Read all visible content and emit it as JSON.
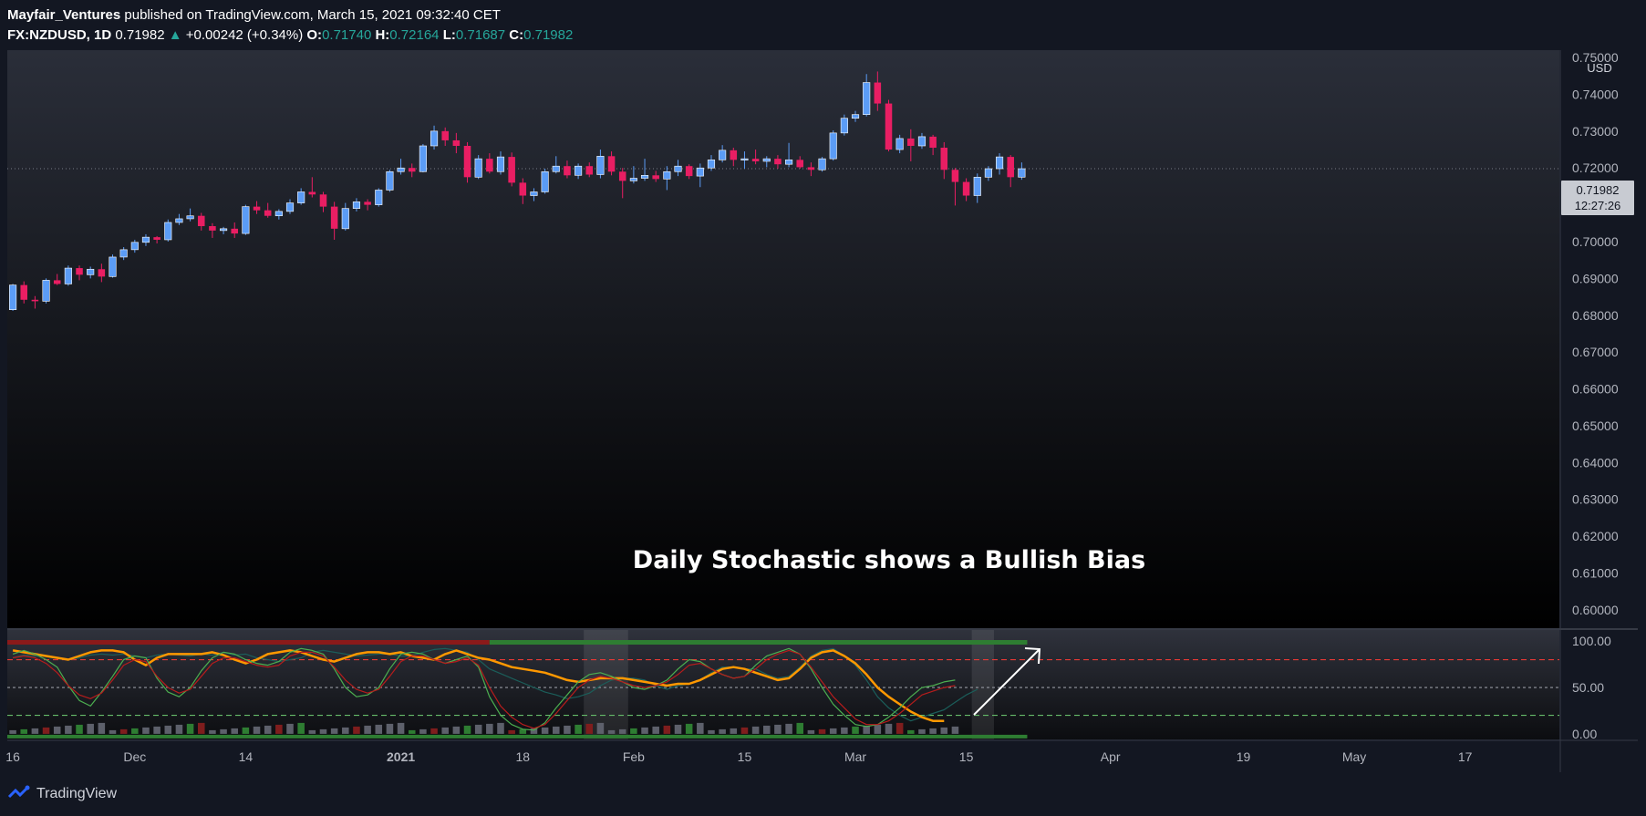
{
  "header": {
    "author": "Mayfair_Ventures",
    "published_text": "published on TradingView.com, March 15, 2021 09:32:40 CET",
    "symbol": "FX:NZDUSD, 1D",
    "last": "0.71982",
    "arrow": "▲",
    "change": "+0.00242 (+0.34%)",
    "o_label": "O:",
    "o": "0.71740",
    "h_label": "H:",
    "h": "0.72164",
    "l_label": "L:",
    "l": "0.71687",
    "c_label": "C:",
    "c": "0.71982"
  },
  "currency_label": "USD",
  "price_tag": {
    "price": "0.71982",
    "countdown": "12:27:26"
  },
  "annotation": "Daily Stochastic shows a Bullish Bias",
  "footer": {
    "brand": "TradingView"
  },
  "colors": {
    "background_top": "#2a2e39",
    "background_bottom": "#000000",
    "up": "#5b9cf6",
    "down": "#e91e63",
    "stoch_k": "#4caf50",
    "stoch_d": "#b71c1c",
    "orange": "#ff9800",
    "overbought_line": "#e53935",
    "oversold_line": "#66bb6a"
  },
  "chart_data": [
    {
      "type": "candlestick",
      "title": "",
      "ylim": [
        0.595,
        0.752
      ],
      "y_ticks": [
        "0.75000",
        "0.74000",
        "0.73000",
        "0.72000",
        "0.71000",
        "0.70000",
        "0.69000",
        "0.68000",
        "0.67000",
        "0.66000",
        "0.65000",
        "0.64000",
        "0.63000",
        "0.62000",
        "0.61000",
        "0.60000"
      ],
      "x_ticks": [
        {
          "label": "16",
          "i": 0
        },
        {
          "label": "Dec",
          "i": 11
        },
        {
          "label": "14",
          "i": 21
        },
        {
          "label": "2021",
          "i": 35
        },
        {
          "label": "18",
          "i": 46
        },
        {
          "label": "Feb",
          "i": 56
        },
        {
          "label": "15",
          "i": 66
        },
        {
          "label": "Mar",
          "i": 76
        },
        {
          "label": "15",
          "i": 86
        },
        {
          "label": "Apr",
          "i": 99
        },
        {
          "label": "19",
          "i": 111
        },
        {
          "label": "May",
          "i": 121
        },
        {
          "label": "17",
          "i": 131
        }
      ],
      "total_slots": 140,
      "last_price": 0.71982,
      "candles": [
        [
          0.6815,
          0.6885,
          0.6812,
          0.6882
        ],
        [
          0.6882,
          0.6892,
          0.6832,
          0.6842
        ],
        [
          0.6842,
          0.6852,
          0.6818,
          0.6838
        ],
        [
          0.6838,
          0.69,
          0.6832,
          0.6895
        ],
        [
          0.6895,
          0.6912,
          0.6882,
          0.6885
        ],
        [
          0.6885,
          0.6935,
          0.688,
          0.6928
        ],
        [
          0.6928,
          0.6935,
          0.6895,
          0.691
        ],
        [
          0.691,
          0.6932,
          0.69,
          0.6925
        ],
        [
          0.6925,
          0.694,
          0.689,
          0.6905
        ],
        [
          0.6905,
          0.6965,
          0.6902,
          0.6958
        ],
        [
          0.6958,
          0.6985,
          0.695,
          0.6978
        ],
        [
          0.6978,
          0.7005,
          0.697,
          0.6998
        ],
        [
          0.6998,
          0.702,
          0.6988,
          0.7012
        ],
        [
          0.7012,
          0.7015,
          0.6995,
          0.7005
        ],
        [
          0.7005,
          0.706,
          0.7,
          0.7052
        ],
        [
          0.7052,
          0.7075,
          0.7045,
          0.7062
        ],
        [
          0.7062,
          0.709,
          0.7055,
          0.707
        ],
        [
          0.707,
          0.7078,
          0.703,
          0.7042
        ],
        [
          0.7042,
          0.705,
          0.701,
          0.703
        ],
        [
          0.703,
          0.704,
          0.702,
          0.7035
        ],
        [
          0.7035,
          0.7052,
          0.701,
          0.7022
        ],
        [
          0.7022,
          0.71,
          0.7018,
          0.7095
        ],
        [
          0.7095,
          0.711,
          0.7075,
          0.7085
        ],
        [
          0.7085,
          0.7105,
          0.7065,
          0.707
        ],
        [
          0.707,
          0.7088,
          0.706,
          0.7082
        ],
        [
          0.7082,
          0.7115,
          0.7075,
          0.7105
        ],
        [
          0.7105,
          0.7145,
          0.71,
          0.7135
        ],
        [
          0.7135,
          0.7175,
          0.712,
          0.7128
        ],
        [
          0.7128,
          0.7135,
          0.708,
          0.7095
        ],
        [
          0.7095,
          0.7108,
          0.7005,
          0.7035
        ],
        [
          0.7035,
          0.7105,
          0.703,
          0.709
        ],
        [
          0.709,
          0.7118,
          0.7082,
          0.7108
        ],
        [
          0.7108,
          0.7115,
          0.7085,
          0.71
        ],
        [
          0.71,
          0.7145,
          0.7095,
          0.714
        ],
        [
          0.714,
          0.7195,
          0.7135,
          0.719
        ],
        [
          0.719,
          0.7225,
          0.7182,
          0.72
        ],
        [
          0.72,
          0.7212,
          0.7175,
          0.719
        ],
        [
          0.719,
          0.7265,
          0.7188,
          0.726
        ],
        [
          0.726,
          0.7315,
          0.725,
          0.73
        ],
        [
          0.73,
          0.731,
          0.726,
          0.7275
        ],
        [
          0.7275,
          0.7295,
          0.724,
          0.726
        ],
        [
          0.726,
          0.727,
          0.716,
          0.7175
        ],
        [
          0.7175,
          0.7235,
          0.717,
          0.7225
        ],
        [
          0.7225,
          0.724,
          0.7185,
          0.719
        ],
        [
          0.719,
          0.7245,
          0.7182,
          0.723
        ],
        [
          0.723,
          0.7242,
          0.715,
          0.716
        ],
        [
          0.716,
          0.7172,
          0.7102,
          0.7125
        ],
        [
          0.7125,
          0.7145,
          0.711,
          0.7135
        ],
        [
          0.7135,
          0.7198,
          0.713,
          0.719
        ],
        [
          0.719,
          0.7232,
          0.7185,
          0.7205
        ],
        [
          0.7205,
          0.722,
          0.7172,
          0.718
        ],
        [
          0.718,
          0.7212,
          0.717,
          0.7205
        ],
        [
          0.7205,
          0.7215,
          0.7175,
          0.7182
        ],
        [
          0.7182,
          0.725,
          0.7172,
          0.7232
        ],
        [
          0.7232,
          0.7245,
          0.718,
          0.719
        ],
        [
          0.719,
          0.72,
          0.7118,
          0.7165
        ],
        [
          0.7165,
          0.7205,
          0.7158,
          0.7172
        ],
        [
          0.7172,
          0.7225,
          0.7165,
          0.718
        ],
        [
          0.718,
          0.7192,
          0.7162,
          0.717
        ],
        [
          0.717,
          0.7205,
          0.714,
          0.719
        ],
        [
          0.719,
          0.7222,
          0.7178,
          0.7205
        ],
        [
          0.7205,
          0.721,
          0.717,
          0.7178
        ],
        [
          0.7178,
          0.7212,
          0.7148,
          0.72
        ],
        [
          0.72,
          0.7235,
          0.7192,
          0.7222
        ],
        [
          0.7222,
          0.7262,
          0.7215,
          0.7248
        ],
        [
          0.7248,
          0.7255,
          0.7205,
          0.7222
        ],
        [
          0.7222,
          0.7245,
          0.7198,
          0.7225
        ],
        [
          0.7225,
          0.725,
          0.721,
          0.7218
        ],
        [
          0.7218,
          0.7232,
          0.7202,
          0.7225
        ],
        [
          0.7225,
          0.7235,
          0.7198,
          0.721
        ],
        [
          0.721,
          0.7268,
          0.7202,
          0.7222
        ],
        [
          0.7222,
          0.7232,
          0.7198,
          0.7202
        ],
        [
          0.7202,
          0.7215,
          0.7178,
          0.7195
        ],
        [
          0.7195,
          0.723,
          0.719,
          0.7225
        ],
        [
          0.7225,
          0.7302,
          0.722,
          0.7295
        ],
        [
          0.7295,
          0.7345,
          0.7288,
          0.7335
        ],
        [
          0.7335,
          0.7355,
          0.7325,
          0.7345
        ],
        [
          0.7345,
          0.7455,
          0.734,
          0.7432
        ],
        [
          0.7432,
          0.7462,
          0.7355,
          0.7375
        ],
        [
          0.7375,
          0.7385,
          0.7245,
          0.725
        ],
        [
          0.725,
          0.729,
          0.724,
          0.728
        ],
        [
          0.728,
          0.7305,
          0.7218,
          0.726
        ],
        [
          0.726,
          0.7295,
          0.7252,
          0.7285
        ],
        [
          0.7285,
          0.729,
          0.7235,
          0.7255
        ],
        [
          0.7255,
          0.727,
          0.717,
          0.7195
        ],
        [
          0.7195,
          0.72,
          0.7098,
          0.7162
        ],
        [
          0.7162,
          0.7172,
          0.711,
          0.7125
        ],
        [
          0.7125,
          0.7185,
          0.7105,
          0.7175
        ],
        [
          0.7175,
          0.7205,
          0.7165,
          0.7198
        ],
        [
          0.7198,
          0.724,
          0.7182,
          0.723
        ],
        [
          0.723,
          0.7235,
          0.7148,
          0.7175
        ],
        [
          0.7175,
          0.7215,
          0.7168,
          0.7198
        ]
      ]
    },
    {
      "type": "line",
      "title": "",
      "ylim": [
        -6,
        112
      ],
      "y_ticks": [
        "100.00",
        "50.00",
        "0.00"
      ],
      "levels": [
        80,
        50,
        20
      ],
      "series": [
        {
          "values": [
            82,
            85,
            84,
            84,
            82,
            80,
            82,
            85,
            86,
            85,
            86,
            84,
            82,
            85,
            86,
            85,
            84,
            86,
            85,
            88,
            85,
            86,
            82,
            80,
            78,
            80,
            82,
            88,
            90,
            88,
            86,
            84,
            85,
            86,
            86,
            84,
            84,
            88,
            91,
            92,
            90,
            88,
            80,
            70,
            65,
            60,
            55,
            50,
            45,
            42,
            38,
            40,
            44,
            52,
            58,
            60,
            60,
            58,
            52,
            48,
            52,
            54,
            58,
            66,
            72,
            72,
            70,
            70,
            64,
            60,
            62,
            72,
            84,
            90,
            92,
            84,
            74,
            58,
            40,
            28,
            20,
            14,
            18,
            22,
            26,
            34,
            42,
            48
          ]
        },
        {
          "values": [
            90,
            88,
            86,
            84,
            82,
            80,
            84,
            88,
            90,
            90,
            88,
            80,
            74,
            82,
            86,
            86,
            86,
            86,
            88,
            85,
            80,
            76,
            80,
            86,
            88,
            90,
            88,
            84,
            80,
            78,
            82,
            86,
            88,
            88,
            86,
            88,
            84,
            82,
            80,
            86,
            90,
            86,
            82,
            80,
            76,
            72,
            70,
            68,
            66,
            62,
            58,
            56,
            58,
            60,
            60,
            60,
            58,
            56,
            54,
            52,
            54,
            54,
            58,
            64,
            70,
            72,
            70,
            66,
            62,
            58,
            60,
            70,
            82,
            88,
            90,
            84,
            76,
            64,
            50,
            40,
            32,
            24,
            18,
            14,
            14
          ]
        },
        {
          "values": [
            86,
            90,
            86,
            80,
            72,
            52,
            36,
            30,
            45,
            62,
            80,
            84,
            82,
            60,
            45,
            40,
            50,
            68,
            82,
            88,
            86,
            80,
            76,
            74,
            78,
            88,
            92,
            90,
            86,
            70,
            50,
            40,
            42,
            50,
            70,
            86,
            88,
            86,
            80,
            76,
            80,
            84,
            72,
            40,
            20,
            10,
            5,
            4,
            12,
            28,
            42,
            56,
            64,
            66,
            62,
            56,
            50,
            48,
            52,
            58,
            70,
            80,
            78,
            70,
            64,
            60,
            62,
            74,
            84,
            88,
            92,
            86,
            70,
            50,
            32,
            20,
            10,
            8,
            10,
            18,
            28,
            40,
            50,
            52,
            56,
            58
          ]
        },
        {
          "values": [
            82,
            84,
            82,
            76,
            66,
            52,
            42,
            38,
            44,
            58,
            74,
            80,
            78,
            62,
            50,
            44,
            48,
            62,
            76,
            82,
            82,
            78,
            74,
            72,
            74,
            84,
            88,
            88,
            84,
            72,
            58,
            48,
            44,
            48,
            62,
            78,
            84,
            84,
            80,
            76,
            78,
            82,
            74,
            50,
            30,
            18,
            10,
            6,
            10,
            22,
            36,
            50,
            58,
            62,
            60,
            56,
            52,
            50,
            52,
            56,
            64,
            74,
            76,
            70,
            64,
            60,
            62,
            70,
            80,
            86,
            90,
            86,
            72,
            56,
            40,
            28,
            16,
            10,
            10,
            14,
            22,
            32,
            42,
            46,
            50,
            52
          ]
        }
      ]
    }
  ]
}
